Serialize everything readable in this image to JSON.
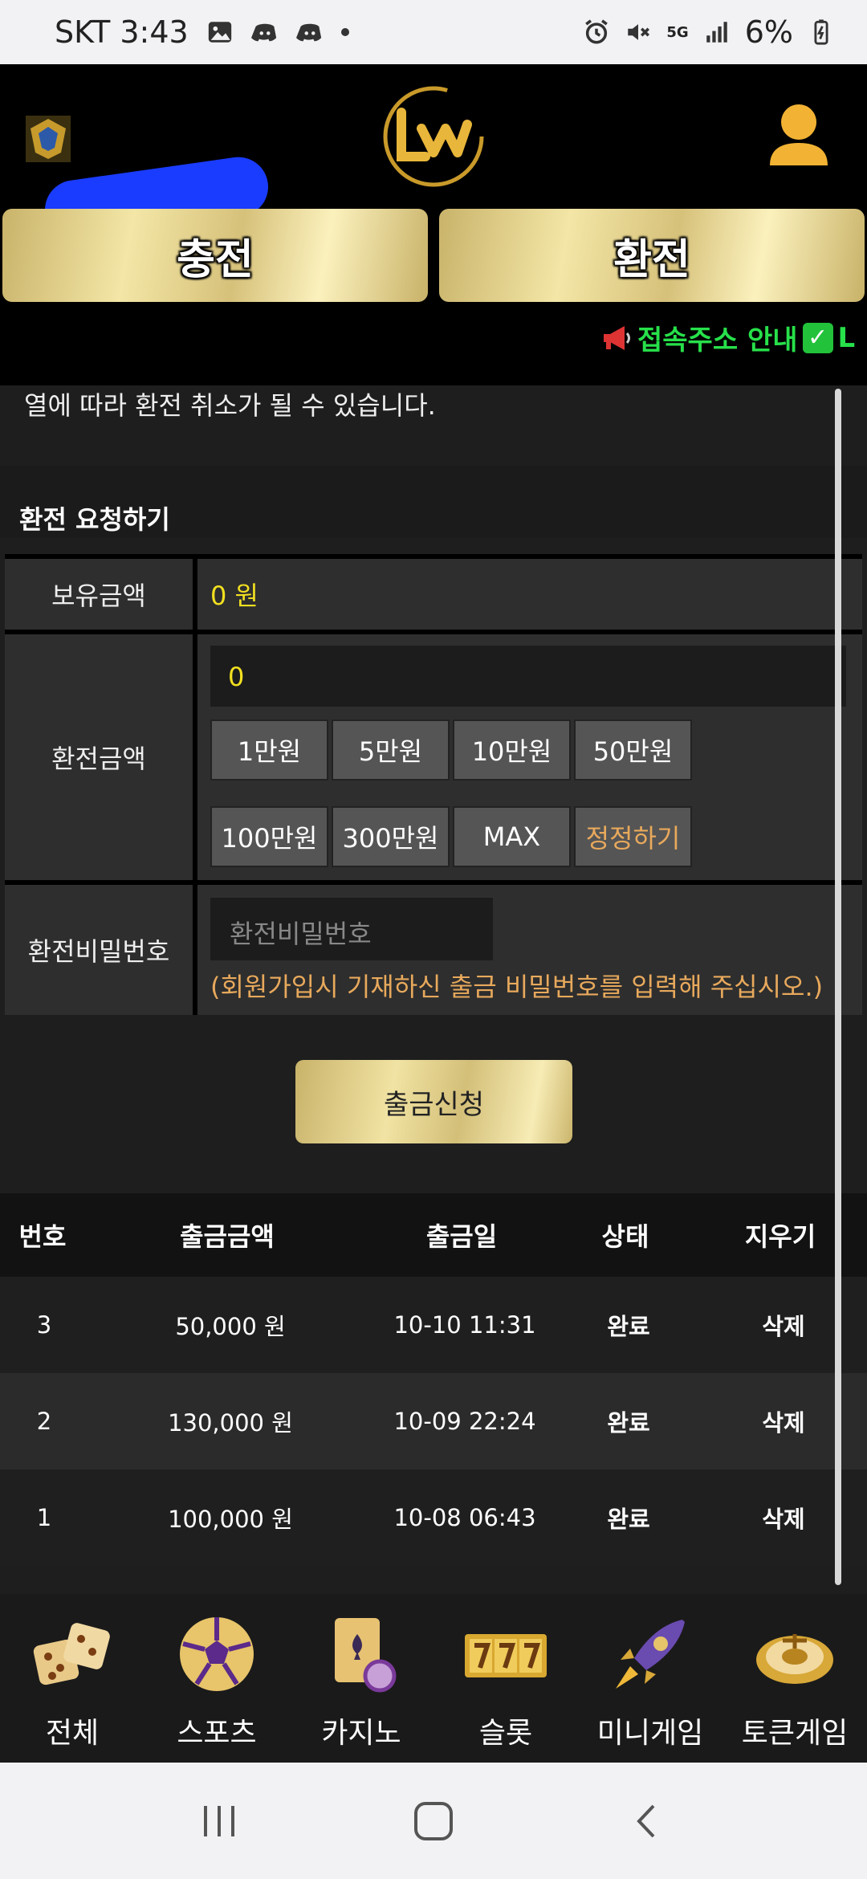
{
  "status_bar": {
    "carrier_time": "SKT 3:43",
    "network": "5G",
    "battery": "6%"
  },
  "header": {
    "deposit_label": "충전",
    "withdraw_label": "환전",
    "marquee_text": "접속주소 안내",
    "marquee_tail": "L"
  },
  "notice_text": "열에 따라 환전 취소가 될 수 있습니다.",
  "section_title": "환전 요청하기",
  "form": {
    "balance_label": "보유금액",
    "balance_value": "0 원",
    "amount_label": "환전금액",
    "amount_value": "0",
    "chips_row1": [
      "1만원",
      "5만원",
      "10만원",
      "50만원"
    ],
    "chips_row2": [
      "100만원",
      "300만원",
      "MAX",
      "정정하기"
    ],
    "password_label": "환전비밀번호",
    "password_placeholder": "환전비밀번호",
    "password_hint": "(회원가입시 기재하신 출금 비밀번호를 입력해 주십시오.)",
    "submit_label": "출금신청"
  },
  "table": {
    "headers": [
      "번호",
      "출금금액",
      "출금일",
      "상태",
      "지우기"
    ],
    "rows": [
      {
        "no": "3",
        "amount": "50,000 원",
        "date": "10-10 11:31",
        "status": "완료",
        "action": "삭제"
      },
      {
        "no": "2",
        "amount": "130,000 원",
        "date": "10-09 22:24",
        "status": "완료",
        "action": "삭제"
      },
      {
        "no": "1",
        "amount": "100,000 원",
        "date": "10-08 06:43",
        "status": "완료",
        "action": "삭제"
      }
    ]
  },
  "bottom_nav": [
    {
      "label": "전체",
      "icon": "dice-icon"
    },
    {
      "label": "스포츠",
      "icon": "soccer-ball-icon"
    },
    {
      "label": "카지노",
      "icon": "cards-chip-icon"
    },
    {
      "label": "슬롯",
      "icon": "slot-777-icon"
    },
    {
      "label": "미니게임",
      "icon": "rocket-icon"
    },
    {
      "label": "토큰게임",
      "icon": "roulette-icon"
    }
  ],
  "colors": {
    "gold": "#d8c47e",
    "yellow_value": "#f2e020",
    "hint_orange": "#e8a95c",
    "marquee_green": "#27e04a"
  }
}
